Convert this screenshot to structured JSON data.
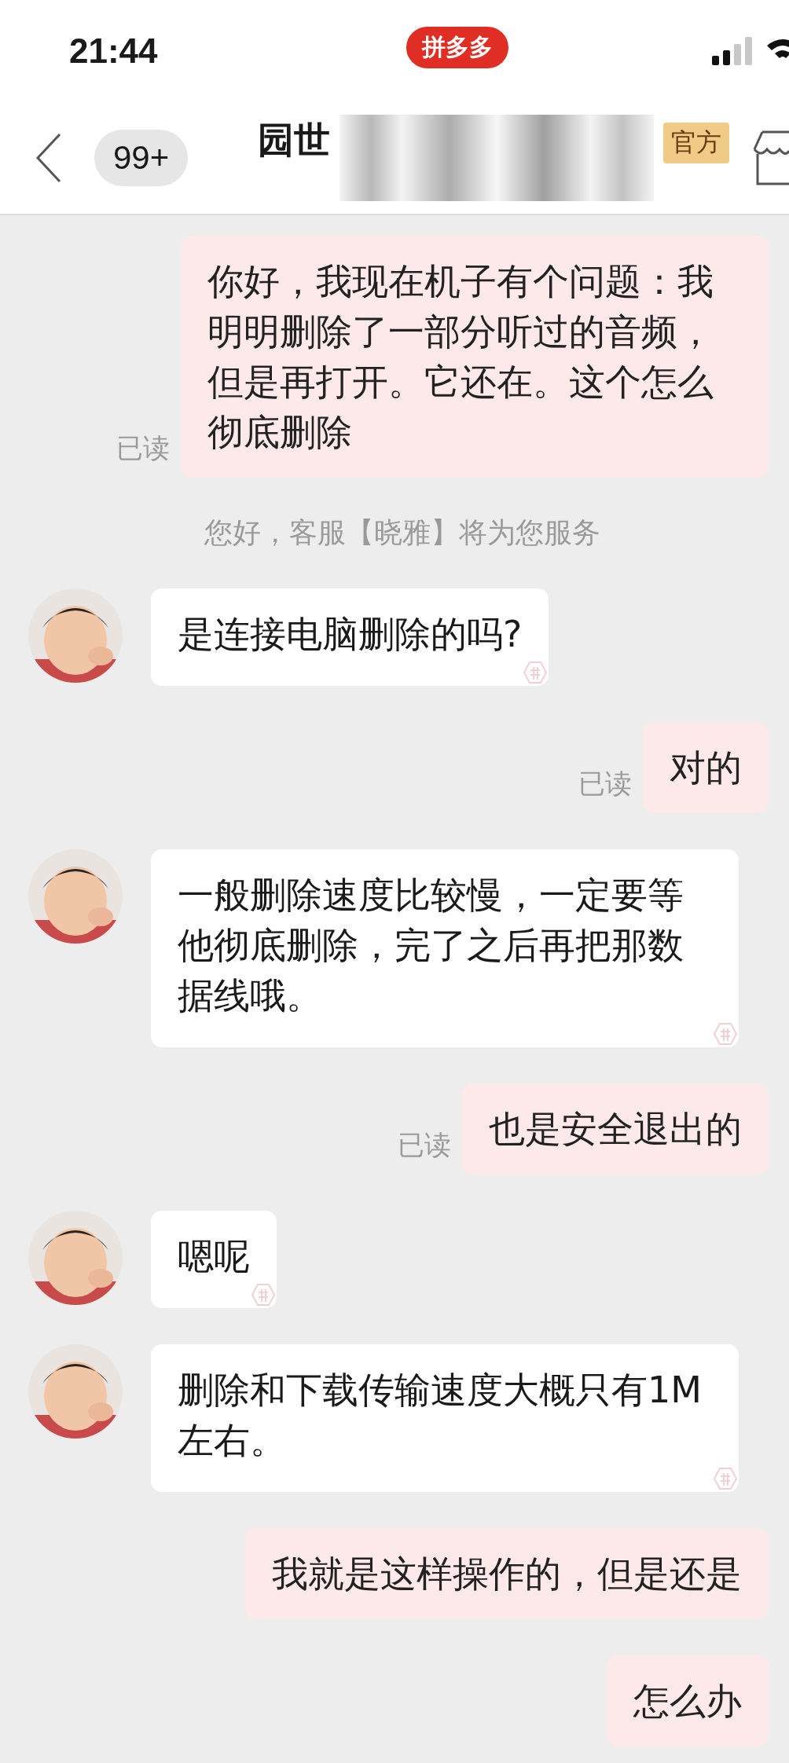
{
  "status_bar": {
    "time": "21:44",
    "app_badge": "拼多多"
  },
  "header": {
    "back_count": "99+",
    "shop_name": "园世",
    "shop_tag": "官方"
  },
  "messages": [
    {
      "kind": "sent",
      "text": "你好，我现在机子有个问题：我明明删除了一部分听过的音频，但是再打开。它还在。这个怎么彻底删除",
      "read_label": "已读"
    },
    {
      "kind": "system",
      "text": "您好，客服【晓雅】将为您服务"
    },
    {
      "kind": "received",
      "text": "是连接电脑删除的吗?"
    },
    {
      "kind": "sent",
      "text": "对的",
      "read_label": "已读"
    },
    {
      "kind": "received",
      "text": "一般删除速度比较慢，一定要等他彻底删除，完了之后再把那数据线哦。"
    },
    {
      "kind": "sent",
      "text": "也是安全退出的",
      "read_label": "已读"
    },
    {
      "kind": "received",
      "text": "嗯呢"
    },
    {
      "kind": "received",
      "text": "删除和下载传输速度大概只有1M左右。"
    },
    {
      "kind": "sent",
      "text": "我就是这样操作的，但是还是"
    },
    {
      "kind": "sent",
      "text": "怎么办"
    }
  ]
}
